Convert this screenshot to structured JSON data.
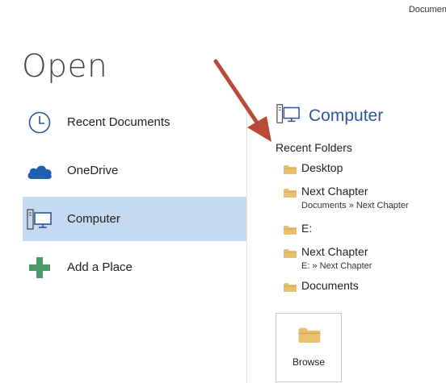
{
  "window": {
    "doc_title": "Document"
  },
  "page": {
    "title": "Open"
  },
  "places": [
    {
      "label": "Recent Documents",
      "icon": "clock-icon"
    },
    {
      "label": "OneDrive",
      "icon": "cloud-icon"
    },
    {
      "label": "Computer",
      "icon": "computer-icon",
      "selected": true
    },
    {
      "label": "Add a Place",
      "icon": "plus-icon"
    }
  ],
  "computer": {
    "header": "Computer",
    "recent_folders_heading": "Recent Folders",
    "folders": [
      {
        "name": "Desktop",
        "path": ""
      },
      {
        "name": "Next Chapter",
        "path": "Documents » Next Chapter"
      },
      {
        "name": "E:",
        "path": ""
      },
      {
        "name": "Next Chapter",
        "path": "E: » Next Chapter"
      },
      {
        "name": "Documents",
        "path": ""
      }
    ],
    "browse_label": "Browse"
  },
  "colors": {
    "accent": "#2b579a",
    "selected_bg": "#c5d9f1",
    "onedrive_blue": "#1e5fb0",
    "add_place_green": "#4c9a6a",
    "folder_yellow": "#e8c170",
    "annotation_arrow": "#b84a3a"
  }
}
